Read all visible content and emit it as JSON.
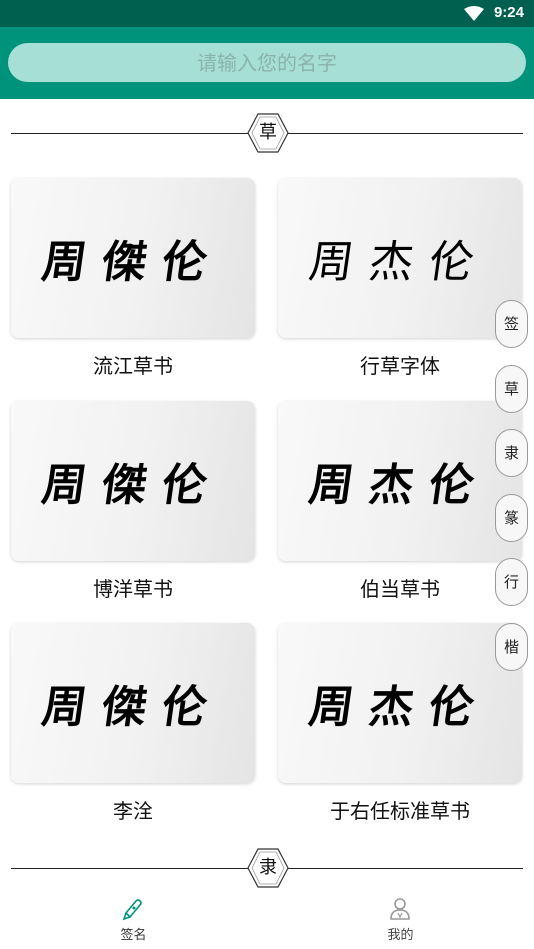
{
  "status_bar": {
    "time": "9:24"
  },
  "search": {
    "placeholder": "请输入您的名字"
  },
  "sections": [
    {
      "label": "草"
    },
    {
      "label": "隶"
    }
  ],
  "cards": [
    {
      "signature": "周傑伦",
      "style": "流江草书"
    },
    {
      "signature": "周杰伦",
      "style": "行草字体"
    },
    {
      "signature": "周傑伦",
      "style": "博洋草书"
    },
    {
      "signature": "周杰伦",
      "style": "伯当草书"
    },
    {
      "signature": "周傑伦",
      "style": "李洤"
    },
    {
      "signature": "周杰伦",
      "style": "于右任标准草书"
    }
  ],
  "side_tabs": [
    "签",
    "草",
    "隶",
    "篆",
    "行",
    "楷"
  ],
  "bottom_nav": [
    {
      "label": "签名",
      "icon": "pen-icon",
      "active": true,
      "color": "#00937c"
    },
    {
      "label": "我的",
      "icon": "person-icon",
      "active": false,
      "color": "#888888"
    }
  ],
  "colors": {
    "status_bar": "#00604f",
    "app_bar": "#00937c",
    "search_bg": "#a6dfd5"
  }
}
